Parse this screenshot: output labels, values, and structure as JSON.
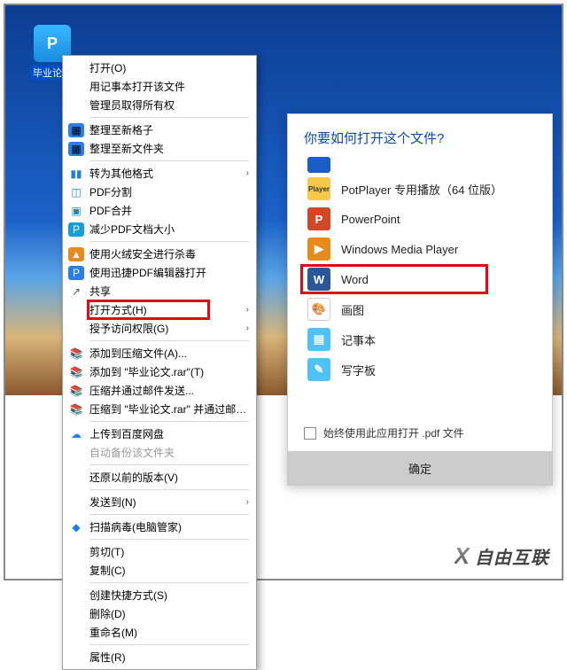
{
  "file": {
    "label": "毕业论文"
  },
  "ctx": {
    "open": "打开(O)",
    "open_notepad": "用记事本打开该文件",
    "admin": "管理员取得所有权",
    "organize_grid": "整理至新格子",
    "organize_folder": "整理至新文件夹",
    "convert_other": "转为其他格式",
    "pdf_split": "PDF分割",
    "pdf_merge": "PDF合并",
    "pdf_shrink": "减少PDF文档大小",
    "huorong": "使用火绒安全进行杀毒",
    "xunjie": "使用迅捷PDF编辑器打开",
    "share": "共享",
    "open_with": "打开方式(H)",
    "grant_access": "授予访问权限(G)",
    "add_archive": "添加到压缩文件(A)...",
    "add_to_rar": "添加到 \"毕业论文.rar\"(T)",
    "compress_email": "压缩并通过邮件发送...",
    "compress_to_rar_email": "压缩到 \"毕业论文.rar\" 并通过邮件发送",
    "upload_baidu": "上传到百度网盘",
    "auto_backup": "自动备份该文件夹",
    "restore_prev": "还原以前的版本(V)",
    "send_to": "发送到(N)",
    "scan_virus": "扫描病毒(电脑管家)",
    "cut": "剪切(T)",
    "copy": "复制(C)",
    "shortcut": "创建快捷方式(S)",
    "delete": "删除(D)",
    "rename": "重命名(M)",
    "properties": "属性(R)"
  },
  "openwith": {
    "title": "你要如何打开这个文件?",
    "apps": [
      {
        "label": "PotPlayer 专用播放（64 位版）",
        "icon": "Player",
        "color": "c-yellow"
      },
      {
        "label": "PowerPoint",
        "icon": "P",
        "color": "c-red"
      },
      {
        "label": "Windows Media Player",
        "icon": "▶",
        "color": "c-orange"
      },
      {
        "label": "Word",
        "icon": "W",
        "color": "c-navy",
        "highlight": true
      },
      {
        "label": "画图",
        "icon": "🎨",
        "color": ""
      },
      {
        "label": "记事本",
        "icon": "📄",
        "color": "c-ltblue"
      },
      {
        "label": "写字板",
        "icon": "✎",
        "color": "c-ltblue"
      }
    ],
    "always": "始终使用此应用打开 .pdf 文件",
    "ok": "确定"
  },
  "watermark": "自由互联"
}
